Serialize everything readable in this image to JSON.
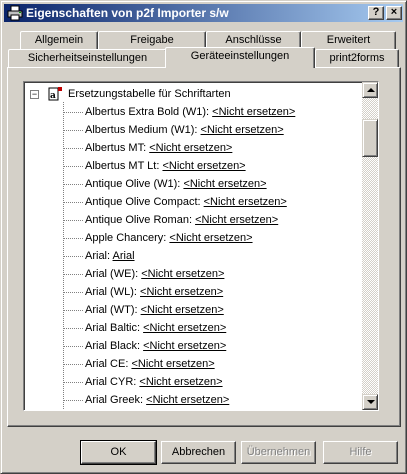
{
  "window": {
    "title": "Eigenschaften von p2f Importer s/w",
    "help_button": "?",
    "close_button": "×"
  },
  "tabs": {
    "row_back": [
      "Allgemein",
      "Freigabe",
      "Anschlüsse",
      "Erweitert"
    ],
    "row_front": [
      "Sicherheitseinstellungen",
      "Geräteeinstellungen",
      "print2forms"
    ],
    "active": "Geräteeinstellungen"
  },
  "tree": {
    "root_label": "Ersetzungstabelle für Schriftarten",
    "expander": "−",
    "items": [
      {
        "font": "Albertus Extra Bold (W1):",
        "value": "<Nicht ersetzen>"
      },
      {
        "font": "Albertus Medium (W1):",
        "value": "<Nicht ersetzen>"
      },
      {
        "font": "Albertus MT:",
        "value": "<Nicht ersetzen>"
      },
      {
        "font": "Albertus MT Lt:",
        "value": "<Nicht ersetzen>"
      },
      {
        "font": "Antique Olive (W1):",
        "value": "<Nicht ersetzen>"
      },
      {
        "font": "Antique Olive Compact:",
        "value": "<Nicht ersetzen>"
      },
      {
        "font": "Antique Olive Roman:",
        "value": "<Nicht ersetzen>"
      },
      {
        "font": "Apple Chancery:",
        "value": "<Nicht ersetzen>"
      },
      {
        "font": "Arial:",
        "value": "Arial"
      },
      {
        "font": "Arial (WE):",
        "value": "<Nicht ersetzen>"
      },
      {
        "font": "Arial (WL):",
        "value": "<Nicht ersetzen>"
      },
      {
        "font": "Arial (WT):",
        "value": "<Nicht ersetzen>"
      },
      {
        "font": "Arial Baltic:",
        "value": "<Nicht ersetzen>"
      },
      {
        "font": "Arial Black:",
        "value": "<Nicht ersetzen>"
      },
      {
        "font": "Arial CE:",
        "value": "<Nicht ersetzen>"
      },
      {
        "font": "Arial CYR:",
        "value": "<Nicht ersetzen>"
      },
      {
        "font": "Arial Greek:",
        "value": "<Nicht ersetzen>"
      }
    ]
  },
  "buttons": {
    "ok": "OK",
    "cancel": "Abbrechen",
    "apply": "Übernehmen",
    "help": "Hilfe"
  }
}
